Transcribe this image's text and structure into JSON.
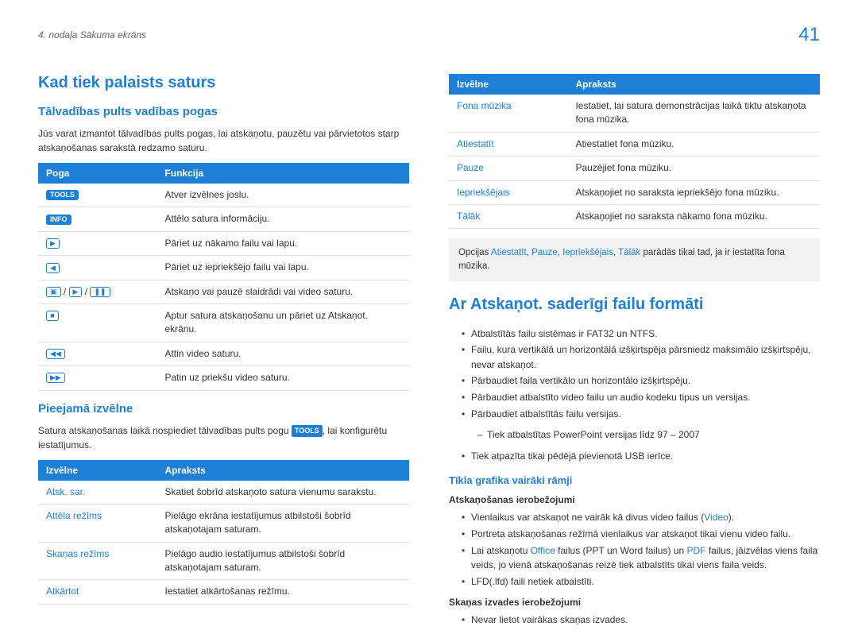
{
  "header": {
    "chapter": "4. nodaļa Sākuma ekrāns",
    "page": "41"
  },
  "left": {
    "h2": "Kad tiek palaists saturs",
    "h3a": "Tālvadības pults vadības pogas",
    "intro": "Jūs varat izmantot tālvadības pults pogas, lai atskaņotu, pauzētu vai pārvietotos starp atskaņošanas sarakstā redzamo saturu.",
    "table1": {
      "th1": "Poga",
      "th2": "Funkcija",
      "rows": [
        {
          "b": "TOOLS",
          "f": "Atver izvēlnes joslu."
        },
        {
          "b": "INFO",
          "f": "Attēlo satura informāciju."
        },
        {
          "b": "▶",
          "f": "Pāriet uz nākamo failu vai lapu."
        },
        {
          "b": "◀",
          "f": "Pāriet uz iepriekšējo failu vai lapu."
        },
        {
          "b": "▣ / ▶ / ❚❚",
          "f": "Atskaņo vai pauzē slaidrādi vai video saturu."
        },
        {
          "b": "■",
          "f": "Aptur satura atskaņošanu un pāriet uz Atskaņot. ekrānu."
        },
        {
          "b": "◀◀",
          "f": "Attin video saturu."
        },
        {
          "b": "▶▶",
          "f": "Patin uz priekšu video saturu."
        }
      ]
    },
    "h3b": "Pieejamā izvēlne",
    "menu_desc_pre": "Satura atskaņošanas laikā nospiediet tālvadības pults pogu ",
    "menu_desc_tools": "TOOLS",
    "menu_desc_post": ", lai konfigurētu iestatījumus.",
    "table2": {
      "th1": "Izvēlne",
      "th2": "Apraksts",
      "rows": [
        {
          "m": "Atsk. sar.",
          "d": "Skatiet šobrīd atskaņoto satura vienumu sarakstu."
        },
        {
          "m": "Attēla režīms",
          "d": "Pielāgo ekrāna iestatījumus atbilstoši šobrīd atskaņotajam saturam."
        },
        {
          "m": "Skaņas režīms",
          "d": "Pielāgo audio iestatījumus atbilstoši šobrīd atskaņotajam saturam."
        },
        {
          "m": "Atkārtot",
          "d": "Iestatiet atkārtošanas režīmu."
        }
      ]
    }
  },
  "right": {
    "table3": {
      "th1": "Izvēlne",
      "th2": "Apraksts",
      "rows": [
        {
          "m": "Fona mūzika",
          "d": "Iestatiet, lai satura demonstrācijas laikā tiktu atskaņota fona mūzika."
        },
        {
          "m": "Atiestatīt",
          "d": "Atiestatiet fona mūziku."
        },
        {
          "m": "Pauze",
          "d": "Pauzējiet fona mūziku."
        },
        {
          "m": "Iepriekšējais",
          "d": "Atskaņojiet no saraksta iepriekšējo fona mūziku."
        },
        {
          "m": "Tālāk",
          "d": "Atskaņojiet no saraksta nākamo fona mūziku."
        }
      ]
    },
    "note_pre": "Opcijas ",
    "note_o1": "Atiestatīt",
    "note_o2": "Pauze",
    "note_o3": "Iepriekšējais",
    "note_o4": "Tālāk",
    "note_post": " parādās tikai tad, ja ir iestatīta fona mūzika.",
    "h2": "Ar Atskaņot. saderīgi failu formāti",
    "bullets1": [
      "Atbalstītās failu sistēmas ir FAT32 un NTFS.",
      "Failu, kura vertikālā un horizontālā izšķirtspēja pārsniedz maksimālo izšķirtspēju, nevar atskaņot.",
      "Pārbaudiet faila vertikālo un horizontālo izšķirtspēju.",
      "Pārbaudiet atbalstīto video failu un audio kodeku tipus un versijas.",
      "Pārbaudiet atbalstītās failu versijas."
    ],
    "sub1": "Tiek atbalstītas PowerPoint versijas līdz 97 – 2007",
    "bullets1b": "Tiek atpazīta tikai pēdējā pievienotā USB ierīce.",
    "h4": "Tīkla grafika vairāki rāmji",
    "h5a": "Atskaņošanas ierobežojumi",
    "b2_1_pre": "Vienlaikus var atskaņot ne vairāk kā divus video failus (",
    "b2_1_video": "Video",
    "b2_1_post": ").",
    "b2_2": "Portreta atskaņošanas režīmā vienlaikus var atskaņot tikai vienu video failu.",
    "b2_3_pre": "Lai atskaņotu ",
    "b2_3_office": "Office",
    "b2_3_mid": " failus (PPT un Word failus) un ",
    "b2_3_pdf": "PDF",
    "b2_3_post": " failus, jāizvēlas viens faila veids, jo vienā atskaņošanas reizē tiek atbalstīts tikai viens faila veids.",
    "b2_4": "LFD(.lfd) faili netiek atbalstīti.",
    "h5b": "Skaņas izvades ierobežojumi",
    "b3_1": "Nevar lietot vairākas skaņas izvades."
  }
}
